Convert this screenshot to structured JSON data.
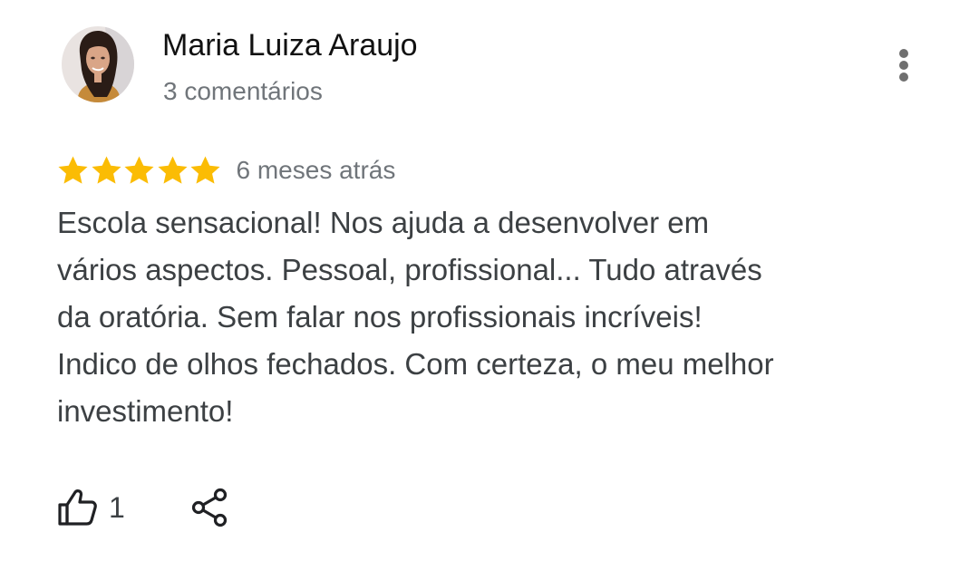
{
  "review": {
    "author_name": "Maria Luiza Araujo",
    "author_meta": "3 comentários",
    "rating": 5,
    "rating_max": 5,
    "time_ago": "6 meses atrás",
    "text_lines": [
      "Escola sensacional! Nos ajuda a desenvolver em",
      "vários aspectos. Pessoal, profissional... Tudo através",
      "da oratória. Sem falar nos profissionais incríveis!",
      "Indico de olhos fechados. Com certeza, o meu melhor",
      "investimento!"
    ],
    "like_count": "1"
  },
  "icons": {
    "more": "more-vert-icon",
    "star": "star-icon",
    "like": "thumb-up-icon",
    "share": "share-icon"
  },
  "colors": {
    "star": "#fbbc04",
    "author_name": "#111111",
    "secondary_text": "#70757a",
    "body_text": "#3c4043",
    "icon": "#202124"
  }
}
